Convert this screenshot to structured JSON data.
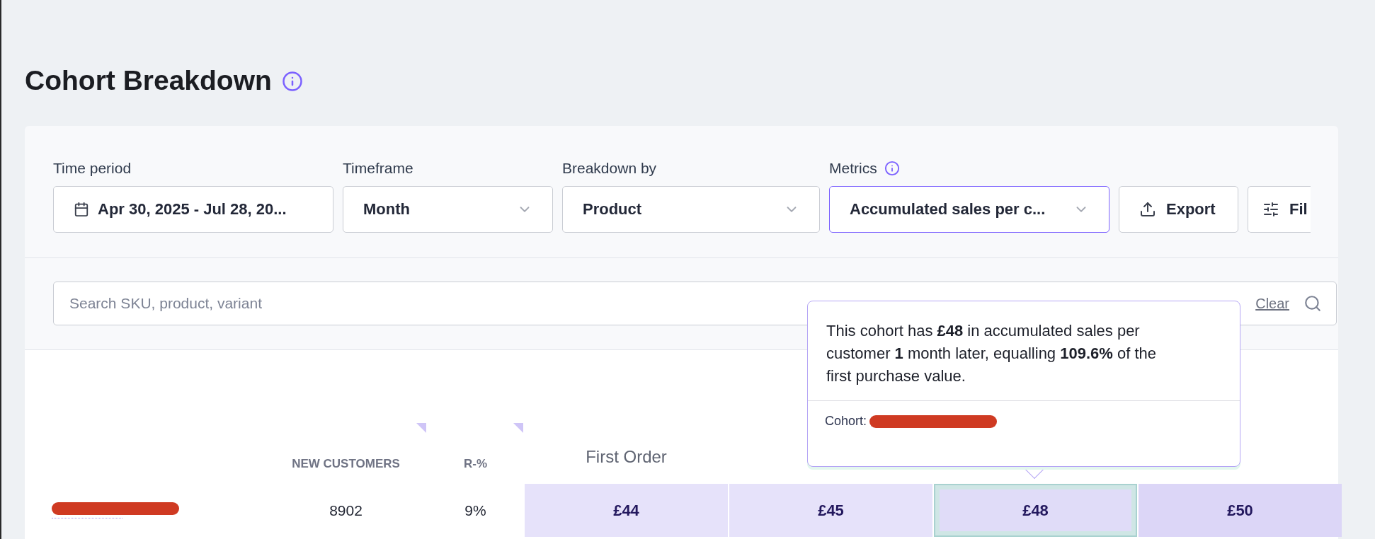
{
  "page": {
    "title": "Cohort Breakdown"
  },
  "filters": [
    {
      "kind": "date",
      "label": "Time period",
      "value": "Apr 30, 2025 - Jul 28, 20...",
      "focused": false
    },
    {
      "kind": "select",
      "label": "Timeframe",
      "value": "Month",
      "focused": false
    },
    {
      "kind": "select",
      "label": "Breakdown by",
      "value": "Product",
      "focused": false
    },
    {
      "kind": "select",
      "label": "Metrics",
      "value": "Accumulated sales per c...",
      "focused": true,
      "info": true
    }
  ],
  "actions": [
    {
      "kind": "export",
      "label": "Export"
    },
    {
      "kind": "filter",
      "label": "Fil"
    }
  ],
  "search": {
    "placeholder": "Search SKU, product, variant",
    "clear": "Clear"
  },
  "table": {
    "columns": [
      {
        "label": "NEW CUSTOMERS",
        "kind": "metric"
      },
      {
        "label": "R-%",
        "kind": "metric"
      }
    ],
    "value_columns": [
      "First Order"
    ],
    "rows": [
      {
        "new_customers": "8902",
        "r_pct": "9%",
        "cells": [
          {
            "value": "£44",
            "color": "#e6e2fa",
            "selected": false
          },
          {
            "value": "£45",
            "color": "#e6e2fa",
            "selected": false
          },
          {
            "value": "£48",
            "color": "#e0dcf8",
            "selected": true
          },
          {
            "value": "£50",
            "color": "#dcd6f7",
            "selected": false
          }
        ]
      }
    ]
  },
  "tooltip": {
    "text": "This cohort has **£48** in accumulated sales per customer **1** month later, equalling **109.6%** of the first purchase value.",
    "cohort_label": "Cohort:"
  }
}
